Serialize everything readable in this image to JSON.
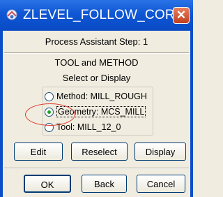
{
  "window": {
    "title": "ZLEVEL_FOLLOW_CORE",
    "close_label": "✕"
  },
  "step_label": "Process Assistant Step: 1",
  "section": {
    "heading": "TOOL and METHOD",
    "subheading": "Select or Display"
  },
  "options": [
    {
      "label": "Method: MILL_ROUGH",
      "checked": false
    },
    {
      "label": "Geometry: MCS_MILL",
      "checked": true
    },
    {
      "label": "Tool: MILL_12_0",
      "checked": false
    }
  ],
  "actions": {
    "edit": "Edit",
    "reselect": "Reselect",
    "display": "Display"
  },
  "dialog_buttons": {
    "ok": "OK",
    "back": "Back",
    "cancel": "Cancel"
  },
  "colors": {
    "titlebar": "#0e56d4",
    "annotation": "#e03a2a",
    "radio_dot": "#21a121"
  }
}
